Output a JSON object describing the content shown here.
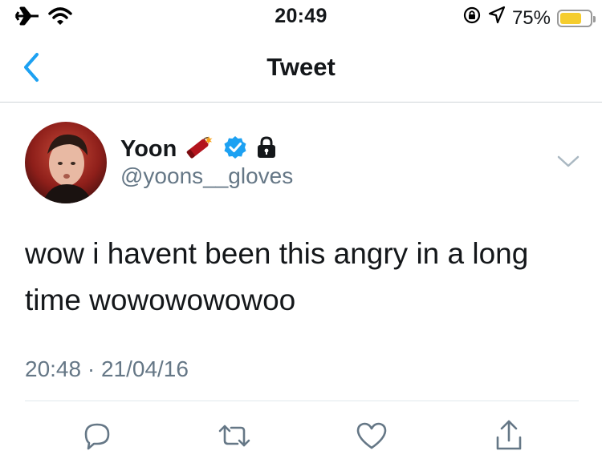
{
  "status_bar": {
    "time": "20:49",
    "battery_percent_label": "75%",
    "battery_level": 0.75,
    "battery_color": "#f5cd2e"
  },
  "nav": {
    "title": "Tweet",
    "accent_color": "#1da1f2"
  },
  "tweet": {
    "author": {
      "display_name": "Yoon",
      "handle": "@yoons__gloves",
      "badges": [
        "firecracker-icon",
        "verified-icon",
        "lock-icon"
      ]
    },
    "text": "wow i havent been this angry in a long time wowowowowoo",
    "timestamp": "20:48 · 21/04/16"
  },
  "actions": [
    "reply-icon",
    "retweet-icon",
    "like-icon",
    "share-icon"
  ]
}
